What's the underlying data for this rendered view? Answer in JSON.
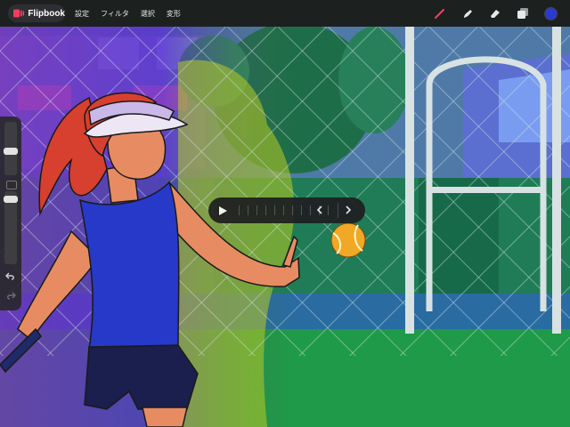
{
  "app": {
    "name": "Flipbook",
    "brand_color": "#ff3b5c"
  },
  "menu": [
    {
      "label": "設定"
    },
    {
      "label": "フィルタ"
    },
    {
      "label": "選択"
    },
    {
      "label": "変形"
    }
  ],
  "tools": {
    "brush": {
      "icon": "brush-icon",
      "active": true,
      "color": "#ff3b5c"
    },
    "smudge": {
      "icon": "smudge-icon"
    },
    "eraser": {
      "icon": "eraser-icon"
    },
    "layers": {
      "icon": "layers-icon"
    },
    "current_color": "#2a3ad0"
  },
  "sidebar": {
    "brush_size_icon": "slider-icon",
    "opacity_icon": "slider-icon",
    "modify_icon": "square-icon",
    "undo_icon": "undo-icon",
    "redo_icon": "redo-icon"
  },
  "player": {
    "play_icon": "play-icon",
    "prev_icon": "chevron-left-icon",
    "next_icon": "chevron-right-icon"
  },
  "canvas": {
    "subject": "tennis-player-illustration"
  }
}
